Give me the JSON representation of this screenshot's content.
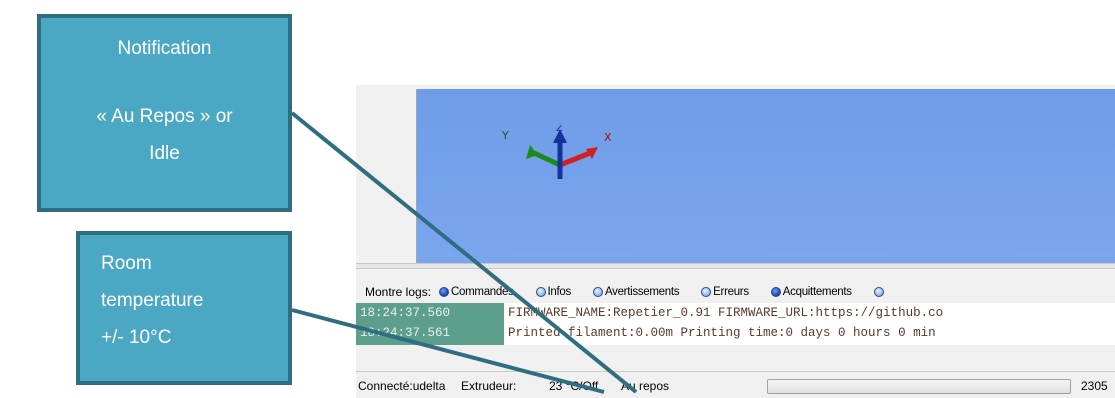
{
  "callouts": {
    "idle": {
      "line1": "Notification",
      "line2": "« Au Repos » or",
      "line3": "Idle"
    },
    "temperature": {
      "line1": "Room",
      "line2": "temperature",
      "line3": "+/- 10°C"
    }
  },
  "log_filter": {
    "label": "Montre logs:",
    "options": [
      {
        "label": "Commandes",
        "checked": true
      },
      {
        "label": "Infos",
        "checked": false
      },
      {
        "label": "Avertissements",
        "checked": false
      },
      {
        "label": "Erreurs",
        "checked": false
      },
      {
        "label": "Acquittements",
        "checked": true
      }
    ]
  },
  "logs": [
    {
      "time": "18:24:37.560",
      "message": "FIRMWARE_NAME:Repetier_0.91 FIRMWARE_URL:https://github.co"
    },
    {
      "time": "18:24:37.561",
      "message": "Printed filament:0.00m Printing time:0 days 0 hours 0 min"
    }
  ],
  "status": {
    "connection": "Connecté:udelta",
    "extruder_label": "Extrudeur:",
    "extruder_value": "23 °C/Off",
    "state": "Au repos",
    "progress": 0,
    "counter": "2305"
  },
  "colors": {
    "callout_fill": "#4aa8c4",
    "callout_border": "#2f6e80",
    "viewport": "#7aa6ee",
    "log_gutter": "#5e9e8c"
  }
}
